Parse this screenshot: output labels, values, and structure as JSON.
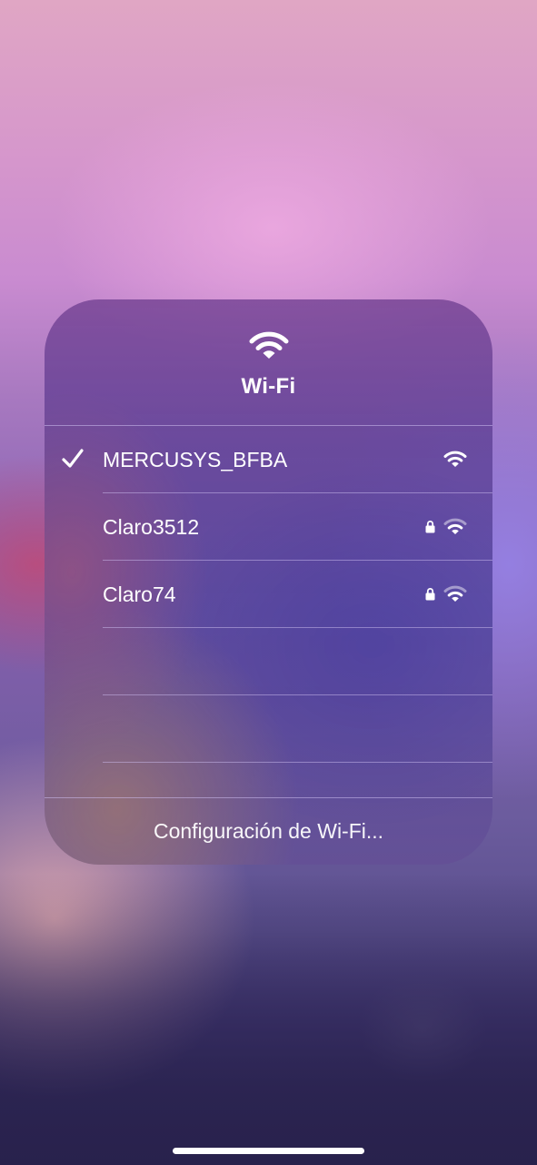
{
  "panel": {
    "header_icon": "wifi-icon",
    "title": "Wi-Fi",
    "networks": [
      {
        "name": "MERCUSYS_BFBA",
        "connected": true,
        "secured": false,
        "icon": "wifi-signal-icon"
      },
      {
        "name": "Claro3512",
        "connected": false,
        "secured": true,
        "icon": "wifi-signal-icon"
      },
      {
        "name": "Claro74",
        "connected": false,
        "secured": true,
        "icon": "wifi-signal-icon"
      }
    ],
    "settings_link": "Configuración de Wi-Fi..."
  },
  "colors": {
    "text": "#ffffff",
    "divider": "#cdbef0",
    "panel_tint": "#6a4a9a"
  }
}
